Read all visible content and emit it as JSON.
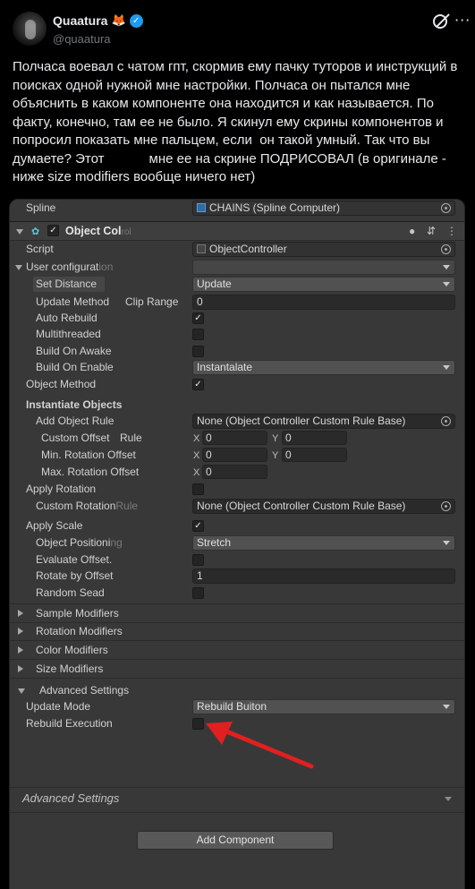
{
  "tweet": {
    "display_name": "Quaatura",
    "fox_emoji": "🦊",
    "verified_mark": "✓",
    "handle": "@quaatura",
    "more_glyph": "···",
    "text": "Полчаса воевал с чатом гпт, скормив ему пачку туторов и инструкций в поисках одной нужной мне настройки. Полчаса он пытался мне объяснить в каком компоненте она находится и как называется. По факту, конечно, там ее не было. Я скинул ему скрины компонентов и попросил показать мне пальцем, если  он такой умный. Так что вы думаете? Этот            мне ее на скрине ПОДРИСОВАЛ (в оригинале - ниже size modifiers вообще ничего нет)"
  },
  "inspector": {
    "spline_label": "Spline",
    "spline_value": "CHAINS (Spline Computer)",
    "component_title": "Object Col",
    "component_title_faded": "rol",
    "header_icons": {
      "dot": "●",
      "sliders": "⇵",
      "kebab": "⋮"
    },
    "script_label": "Script",
    "script_value": "ObjectController",
    "user_config_label": "User configurat",
    "user_config_faded": "ion",
    "set_distance_label": "Set Distance",
    "set_distance_value": "Update",
    "update_method_label": "Update Method",
    "clip_range_label": "Clip Range",
    "clip_range_value": "0",
    "auto_rebuild_label": "Auto Rebuild",
    "multithreaded_label": "Multithreaded",
    "build_on_awake_label": "Build On Awake",
    "build_on_enable_label": "Build On Enable",
    "build_on_enable_value": "Instantalate",
    "object_method_label": "Object Method",
    "instantiate_objects_label": "Instantiate Objects",
    "add_object_rule_label": "Add Object Rule",
    "add_object_rule_value": "None (Object Controller Custom Rule Base)",
    "custom_offset_label": "Custom Offset",
    "custom_offset_rule": "Rule",
    "custom_offset_x": "0",
    "custom_offset_y": "0",
    "min_rotation_label": "Min. Rotation Offset",
    "min_rotation_x": "0",
    "min_rotation_y": "0",
    "max_rotation_label": "Max. Rotation Offset",
    "max_rotation_x": "0",
    "axis_x": "X",
    "axis_y": "Y",
    "apply_rotation_label": "Apply Rotation",
    "custom_rotation_label": "Custom Rotation",
    "custom_rotation_faded": "Rule",
    "custom_rotation_value": "None (Object Controller Custom Rule Base)",
    "apply_scale_label": "Apply Scale",
    "object_positioning_label": "Object Positioni",
    "object_positioning_faded": "ng",
    "object_positioning_value": "Stretch",
    "evaluate_offset_label": "Evaluate Offset.",
    "rotate_by_offset_label": "Rotate by Offset",
    "rotate_by_offset_value": "1",
    "random_sead_label": "Random Sead",
    "sample_modifiers_label": "Sample Modifiers",
    "rotation_modifiers_label": "Rotation Modifiers",
    "color_modifiers_label": "Color Modifiers",
    "size_modifiers_label": "Size Modifiers",
    "advanced_settings_label": "Advanced Settings",
    "update_mode_label": "Update Mode",
    "update_mode_value": "Rebuild Buiton",
    "rebuild_execution_label": "Rebuild Execution",
    "advanced_settings_footer": "Advanced Settings",
    "check_mark": "✓",
    "add_component_label": "Add Component"
  },
  "colors": {
    "inspector_bg": "#383838",
    "arrow_red": "#e02020",
    "verified_blue": "#1d9bf0"
  }
}
